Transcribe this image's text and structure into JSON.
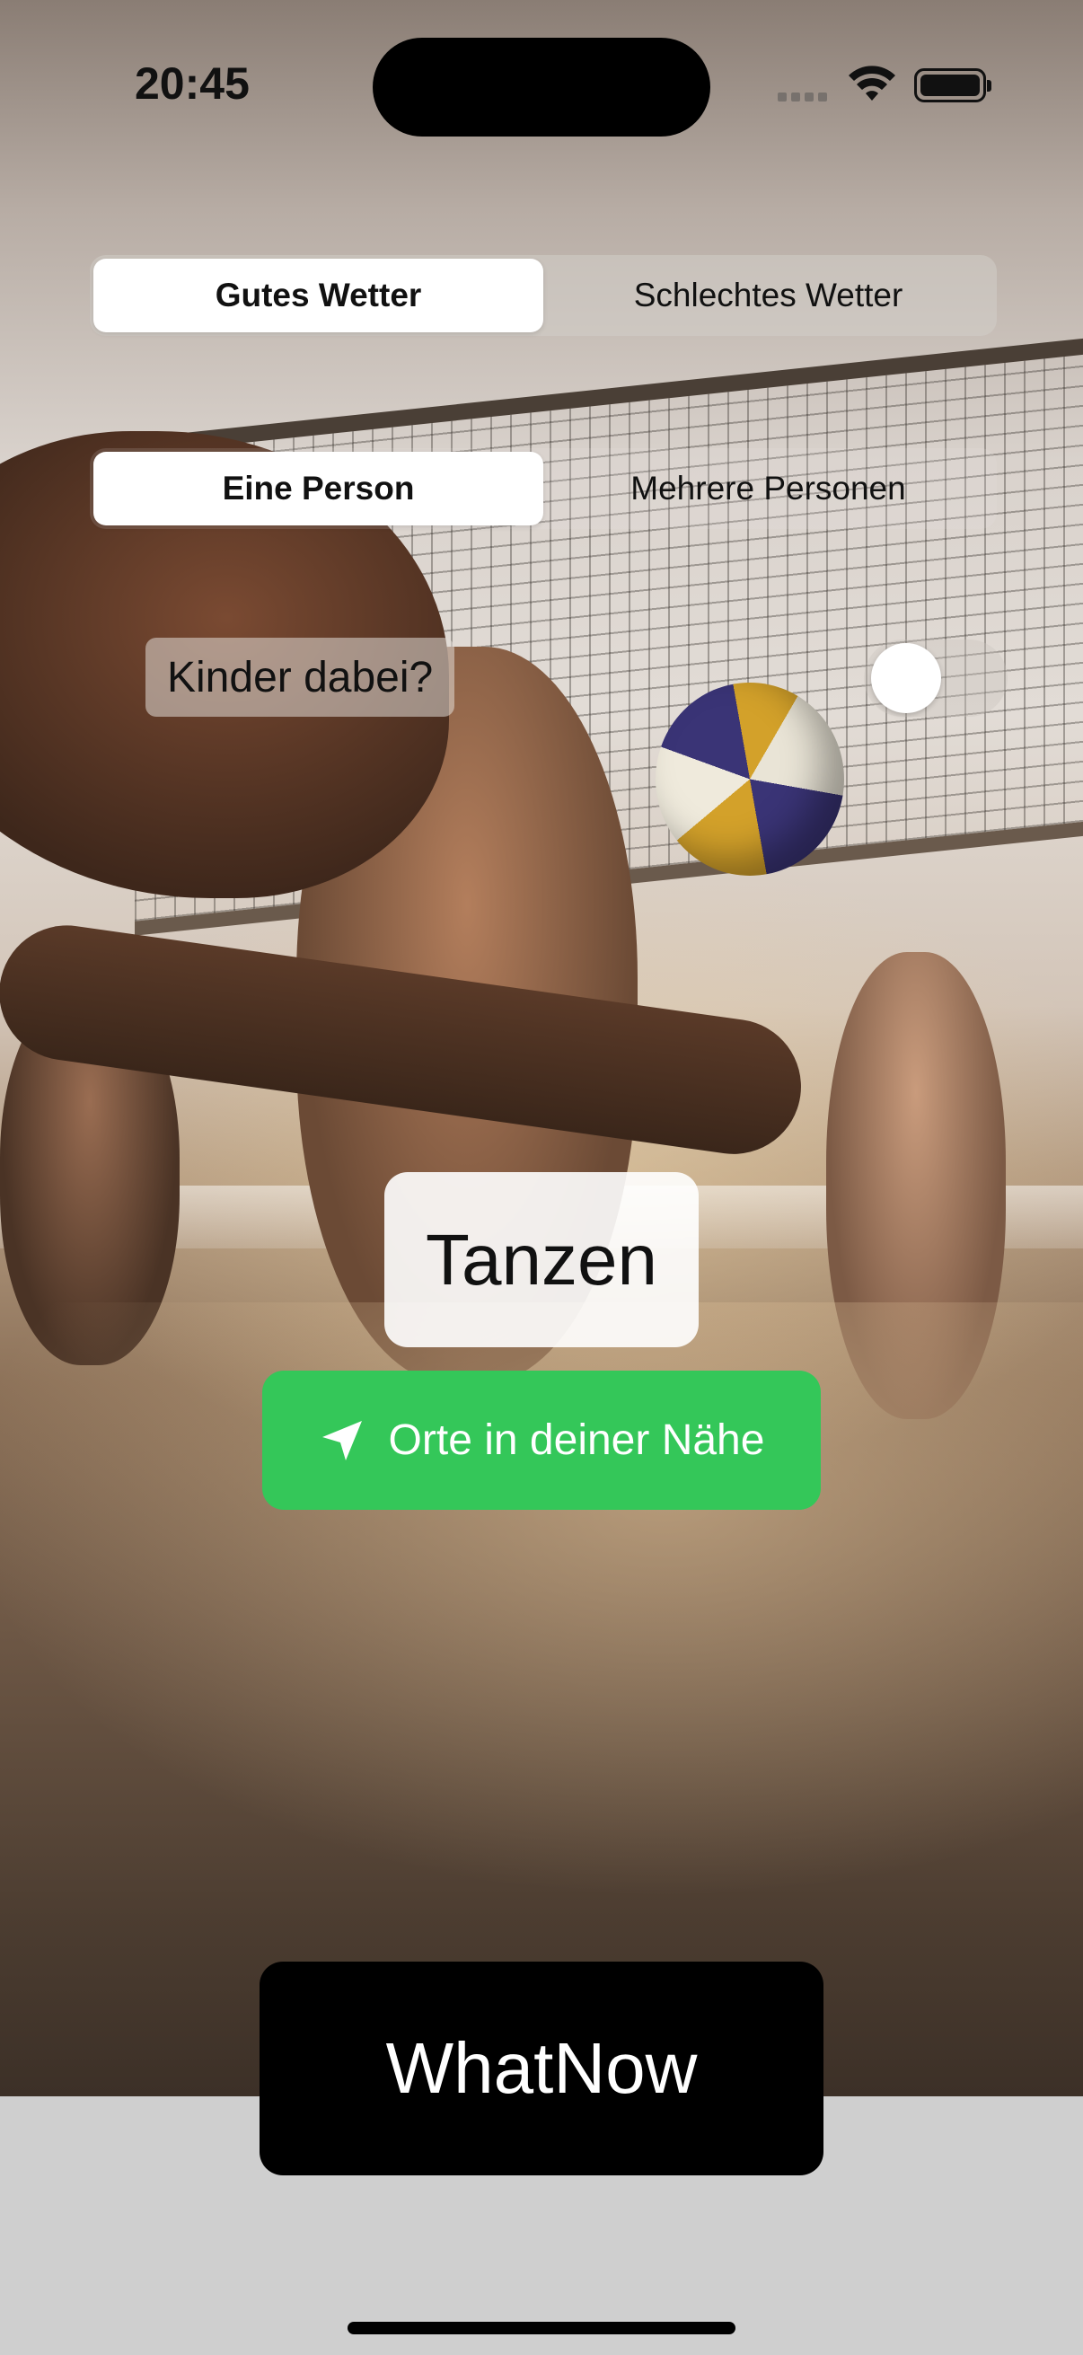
{
  "status_bar": {
    "time": "20:45"
  },
  "weather_segment": {
    "options": [
      "Gutes Wetter",
      "Schlechtes Wetter"
    ],
    "selected": "Gutes Wetter"
  },
  "persons_segment": {
    "options": [
      "Eine Person",
      "Mehrere Personen"
    ],
    "selected": "Eine Person"
  },
  "kids": {
    "label": "Kinder dabei?",
    "toggle_on": false
  },
  "activity": {
    "label": "Tanzen"
  },
  "nearby_button": {
    "label": "Orte in deiner Nähe",
    "icon": "location-arrow-icon",
    "color": "#34c759"
  },
  "main_button": {
    "label": "WhatNow"
  }
}
